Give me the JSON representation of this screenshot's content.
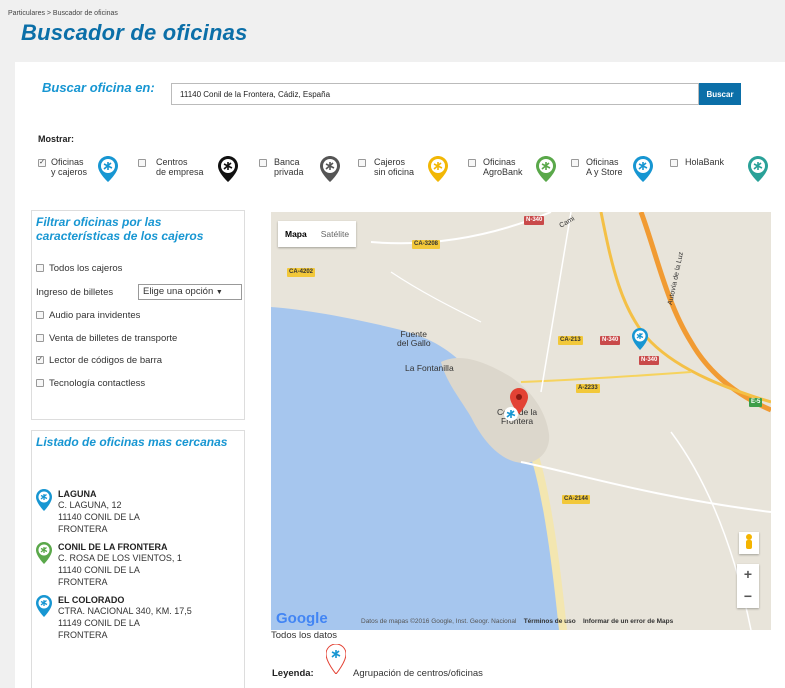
{
  "breadcrumb": "Particulares > Buscador de oficinas",
  "page_title": "Buscador de oficinas",
  "search": {
    "label": "Buscar oficina en:",
    "value": "11140 Conil de la Frontera, Cádiz, España",
    "button": "Buscar"
  },
  "show": {
    "label": "Mostrar:",
    "filters": [
      {
        "line1": "Oficinas",
        "line2": "y cajeros",
        "checked": true,
        "pin_color": "#1796d2",
        "icon": "caixa-star-icon"
      },
      {
        "line1": "Centros",
        "line2": "de empresa",
        "checked": false,
        "pin_color": "#111111",
        "icon": "caixa-star-icon"
      },
      {
        "line1": "Banca",
        "line2": "privada",
        "checked": false,
        "pin_color": "#555555",
        "icon": "caixa-star-icon"
      },
      {
        "line1": "Cajeros",
        "line2": "sin oficina",
        "checked": false,
        "pin_color": "#f2b705",
        "icon": "caixa-star-icon"
      },
      {
        "line1": "Oficinas",
        "line2": "AgroBank",
        "checked": false,
        "pin_color": "#5aa84a",
        "icon": "caixa-star-icon"
      },
      {
        "line1": "Oficinas",
        "line2": "A y Store",
        "checked": false,
        "pin_color": "#1796d2",
        "icon": "caixa-star-icon"
      },
      {
        "line1": "HolaBank",
        "line2": "",
        "checked": false,
        "pin_color": "#2aa198",
        "icon": "caixa-star-icon"
      }
    ]
  },
  "atm_filter": {
    "title": "Filtrar oficinas por las características de los cajeros",
    "all_atms": "Todos los cajeros",
    "cash_deposit_label": "Ingreso de billetes",
    "cash_deposit_select": "Elige una opción",
    "options": [
      {
        "label": "Audio para invidentes",
        "checked": false
      },
      {
        "label": "Venta de billetes de transporte",
        "checked": false
      },
      {
        "label": "Lector de códigos de barra",
        "checked": true
      },
      {
        "label": "Tecnología contactless",
        "checked": false
      }
    ]
  },
  "office_list": {
    "title": "Listado de oficinas mas cercanas",
    "offices": [
      {
        "name": "LAGUNA",
        "address": "C. LAGUNA, 12",
        "city1": "11140 CONIL DE LA",
        "city2": "FRONTERA",
        "pin_color": "#1796d2"
      },
      {
        "name": "CONIL DE LA FRONTERA",
        "address": "C. ROSA DE LOS VIENTOS, 1",
        "city1": "11140 CONIL DE LA",
        "city2": "FRONTERA",
        "pin_color": "#5aa84a"
      },
      {
        "name": "EL COLORADO",
        "address": "CTRA. NACIONAL 340, KM. 17,5",
        "city1": "11149 CONIL DE LA",
        "city2": "FRONTERA",
        "pin_color": "#1796d2"
      }
    ]
  },
  "map": {
    "type_map": "Mapa",
    "type_satellite": "Satélite",
    "places": {
      "fuente": "Fuente",
      "del_gallo": "del Gallo",
      "fontanilla": "La Fontanilla",
      "conil1": "Conil de la",
      "conil2": "Frontera",
      "autovia": "Autovía de la Luz",
      "camino": "Cami"
    },
    "roads": {
      "n340a": "N-340",
      "n340b": "N-340",
      "n340c": "N-340",
      "ca3208": "CA-3208",
      "ca4202": "CA-4202",
      "ca213": "CA-213",
      "a2233": "A-2233",
      "ca2144": "CA-2144",
      "e5": "E-5"
    },
    "google": "Google",
    "attribution": "Datos de mapas ©2016 Google, Inst. Geogr. Nacional",
    "terms": "Términos de uso",
    "report": "Informar de un error de Maps",
    "zoom_in": "+",
    "zoom_out": "−"
  },
  "all_data": "Todos los datos",
  "legend": {
    "label": "Leyenda:",
    "text": "Agrupación de centros/oficinas"
  },
  "colors": {
    "brand_blue": "#0b6fa8",
    "accent_blue": "#1796d2",
    "water": "#a6c6ee",
    "land": "#e8e4da"
  }
}
